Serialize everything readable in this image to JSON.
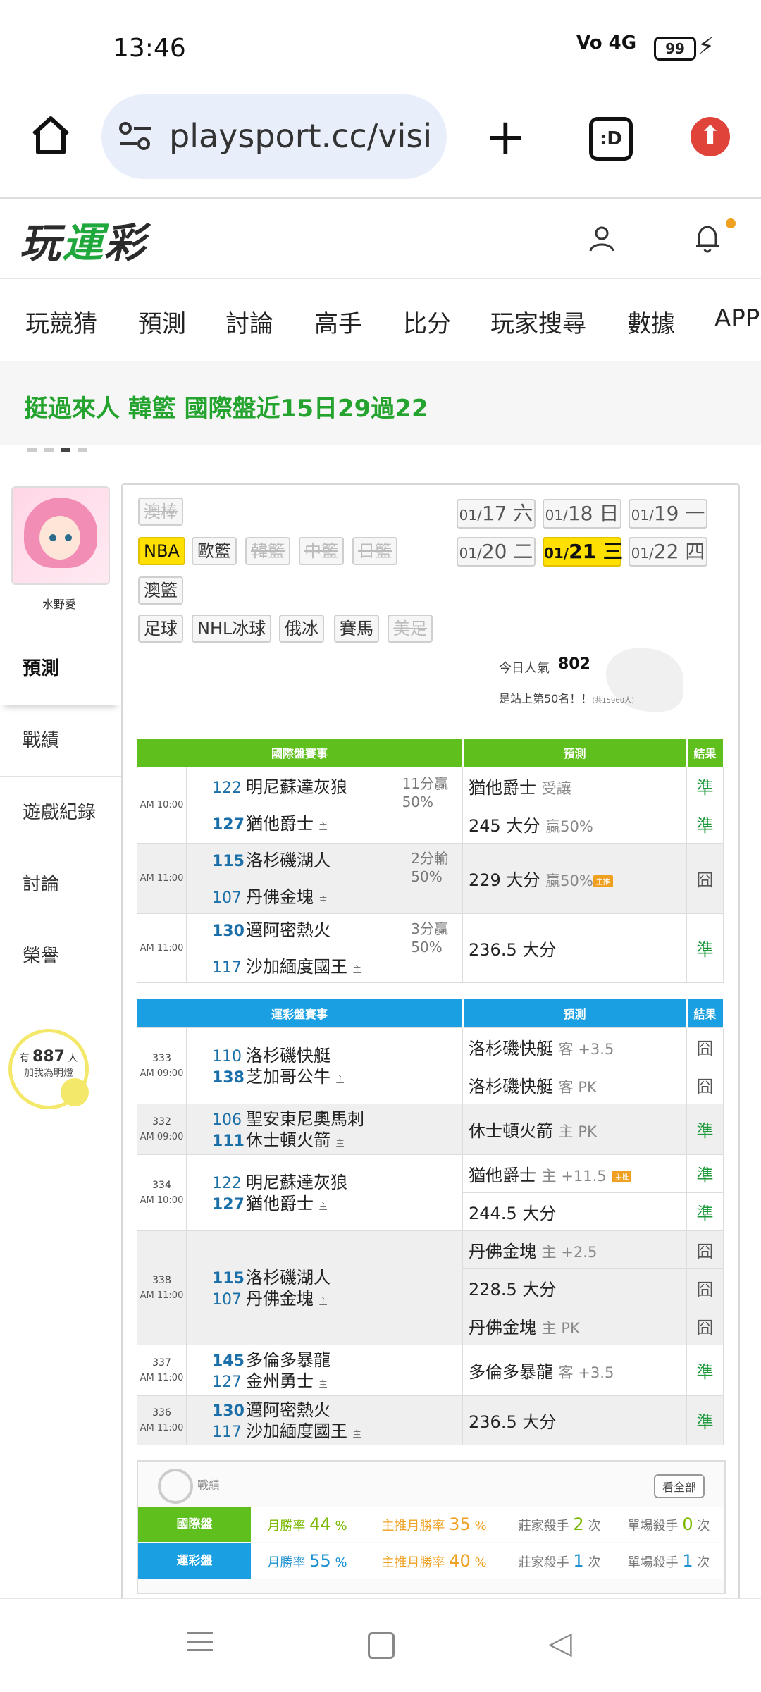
{
  "status": {
    "time": "13:46",
    "signal": "Vo 4G",
    "battery": "99"
  },
  "browser": {
    "url": "playsport.cc/visit"
  },
  "site": {
    "logo_prefix": "玩",
    "logo_green": "運",
    "logo_suffix": "彩"
  },
  "nav": [
    "玩競猜",
    "預測",
    "討論",
    "高手",
    "比分",
    "玩家搜尋",
    "數據",
    "APP"
  ],
  "banner": {
    "text": "挺過來人 韓籃 國際盤近15日29過22"
  },
  "profile": {
    "name": "水野愛"
  },
  "side_menu": [
    "預測",
    "戰績",
    "遊戲紀錄",
    "討論",
    "榮譽"
  ],
  "fans": {
    "prefix": "有",
    "count": "887",
    "unit": "人",
    "cta": "加我為明燈"
  },
  "sports": {
    "row0": [
      "澳棒"
    ],
    "row1": [
      "NBA",
      "歐籃",
      "韓籃",
      "中籃",
      "日籃"
    ],
    "row2": [
      "澳籃"
    ],
    "row3": [
      "足球",
      "NHL冰球",
      "俄冰",
      "賽馬",
      "美足"
    ]
  },
  "dates": [
    {
      "md": "01/",
      "d": "17",
      "w": "六"
    },
    {
      "md": "01/",
      "d": "18",
      "w": "日"
    },
    {
      "md": "01/",
      "d": "19",
      "w": "一"
    },
    {
      "md": "01/",
      "d": "20",
      "w": "二"
    },
    {
      "md": "01/",
      "d": "21",
      "w": "三"
    },
    {
      "md": "01/",
      "d": "22",
      "w": "四"
    }
  ],
  "popularity": {
    "label": "今日人氣",
    "value": "802",
    "rank": "是站上第50名！！",
    "total": "(共15960人)"
  },
  "intl": {
    "headers": [
      "國際盤賽事",
      "預測",
      "結果"
    ],
    "games": [
      {
        "time": "AM 10:00",
        "away_no": "122",
        "away": "明尼蘇達灰狼",
        "home_no": "127",
        "home": "猶他爵士",
        "odds1": "11分贏",
        "odds2": "50%",
        "picks": [
          {
            "main": "猶他爵士",
            "sub": "受讓",
            "res": "準"
          },
          {
            "main": "245 大分",
            "sub": "贏50%",
            "res": "準"
          }
        ]
      },
      {
        "time": "AM 11:00",
        "away_no": "115",
        "away": "洛杉磯湖人",
        "home_no": "107",
        "home": "丹佛金塊",
        "odds1": "2分輸",
        "odds2": "50%",
        "picks": [
          {
            "main": "229 大分",
            "sub": "贏50%",
            "badge": "主推",
            "res": "囧"
          }
        ]
      },
      {
        "time": "AM 11:00",
        "away_no": "130",
        "away": "邁阿密熱火",
        "home_no": "117",
        "home": "沙加緬度國王",
        "odds1": "3分贏",
        "odds2": "50%",
        "picks": [
          {
            "main": "236.5 大分",
            "sub": "",
            "res": "準"
          }
        ]
      }
    ]
  },
  "lottery": {
    "headers": [
      "運彩盤賽事",
      "預測",
      "結果"
    ],
    "games": [
      {
        "gid": "333",
        "time": "AM 09:00",
        "away_no": "110",
        "away": "洛杉磯快艇",
        "home_no": "138",
        "home": "芝加哥公牛",
        "picks": [
          {
            "main": "洛杉磯快艇",
            "sub": "客 +3.5",
            "res": "囧"
          },
          {
            "main": "洛杉磯快艇",
            "sub": "客 PK",
            "res": "囧"
          }
        ]
      },
      {
        "gid": "332",
        "time": "AM 09:00",
        "away_no": "106",
        "away": "聖安東尼奧馬刺",
        "home_no": "111",
        "home": "休士頓火箭",
        "picks": [
          {
            "main": "休士頓火箭",
            "sub": "主 PK",
            "res": "準"
          }
        ]
      },
      {
        "gid": "334",
        "time": "AM 10:00",
        "away_no": "122",
        "away": "明尼蘇達灰狼",
        "home_no": "127",
        "home": "猶他爵士",
        "picks": [
          {
            "main": "猶他爵士",
            "sub": "主 +11.5",
            "badge": "主推",
            "res": "準"
          },
          {
            "main": "244.5 大分",
            "sub": "",
            "res": "準"
          }
        ]
      },
      {
        "gid": "338",
        "time": "AM 11:00",
        "away_no": "115",
        "away": "洛杉磯湖人",
        "home_no": "107",
        "home": "丹佛金塊",
        "picks": [
          {
            "main": "丹佛金塊",
            "sub": "主 +2.5",
            "res": "囧"
          },
          {
            "main": "228.5 大分",
            "sub": "",
            "res": "囧"
          },
          {
            "main": "丹佛金塊",
            "sub": "主 PK",
            "res": "囧"
          }
        ]
      },
      {
        "gid": "337",
        "time": "AM 11:00",
        "away_no": "145",
        "away": "多倫多暴龍",
        "home_no": "127",
        "home": "金州勇士",
        "picks": [
          {
            "main": "多倫多暴龍",
            "sub": "客 +3.5",
            "res": "準"
          }
        ]
      },
      {
        "gid": "336",
        "time": "AM 11:00",
        "away_no": "130",
        "away": "邁阿密熱火",
        "home_no": "117",
        "home": "沙加緬度國王",
        "picks": [
          {
            "main": "236.5 大分",
            "sub": "",
            "res": "準"
          }
        ]
      }
    ]
  },
  "home_mark": "主",
  "record": {
    "title": "戰績",
    "view_all": "看全部",
    "rows": [
      {
        "label": "國際盤",
        "color": "#5fbf1c",
        "month_label": "月勝率",
        "month": "44",
        "main_label": "主推月勝率",
        "main": "35",
        "kill_label": "莊家殺手",
        "kill": "2",
        "single_label": "單場殺手",
        "single": "0",
        "unit": "次",
        "pct": "%"
      },
      {
        "label": "運彩盤",
        "color": "#1aa0e2",
        "month_label": "月勝率",
        "month": "55",
        "main_label": "主推月勝率",
        "main": "40",
        "kill_label": "莊家殺手",
        "kill": "1",
        "single_label": "單場殺手",
        "single": "1",
        "unit": "次",
        "pct": "%"
      }
    ]
  },
  "colors": {
    "accent_green": "#24a32e",
    "header_green": "#5fbf1c",
    "header_blue": "#1aa0e2",
    "highlight": "#ffe000",
    "win": "#1f9a3d"
  }
}
